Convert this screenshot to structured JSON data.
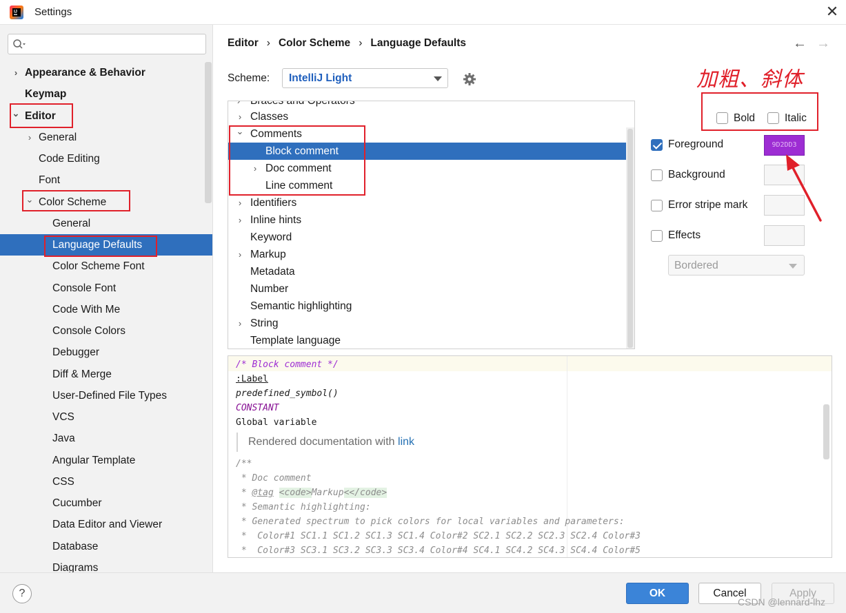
{
  "window": {
    "title": "Settings"
  },
  "search": {
    "placeholder": ""
  },
  "sidebar": {
    "items": [
      {
        "label": "Appearance & Behavior",
        "level": 0,
        "chevron": "right",
        "bold": true
      },
      {
        "label": "Keymap",
        "level": 0,
        "chevron": "none",
        "bold": true
      },
      {
        "label": "Editor",
        "level": 0,
        "chevron": "down",
        "bold": true
      },
      {
        "label": "General",
        "level": 1,
        "chevron": "right"
      },
      {
        "label": "Code Editing",
        "level": 1,
        "chevron": "none"
      },
      {
        "label": "Font",
        "level": 1,
        "chevron": "none"
      },
      {
        "label": "Color Scheme",
        "level": 1,
        "chevron": "down"
      },
      {
        "label": "General",
        "level": 2,
        "chevron": "none"
      },
      {
        "label": "Language Defaults",
        "level": 2,
        "chevron": "none",
        "selected": true
      },
      {
        "label": "Color Scheme Font",
        "level": 2,
        "chevron": "none"
      },
      {
        "label": "Console Font",
        "level": 2,
        "chevron": "none"
      },
      {
        "label": "Code With Me",
        "level": 2,
        "chevron": "none"
      },
      {
        "label": "Console Colors",
        "level": 2,
        "chevron": "none"
      },
      {
        "label": "Debugger",
        "level": 2,
        "chevron": "none"
      },
      {
        "label": "Diff & Merge",
        "level": 2,
        "chevron": "none"
      },
      {
        "label": "User-Defined File Types",
        "level": 2,
        "chevron": "none"
      },
      {
        "label": "VCS",
        "level": 2,
        "chevron": "none"
      },
      {
        "label": "Java",
        "level": 2,
        "chevron": "none"
      },
      {
        "label": "Angular Template",
        "level": 2,
        "chevron": "none"
      },
      {
        "label": "CSS",
        "level": 2,
        "chevron": "none"
      },
      {
        "label": "Cucumber",
        "level": 2,
        "chevron": "none"
      },
      {
        "label": "Data Editor and Viewer",
        "level": 2,
        "chevron": "none"
      },
      {
        "label": "Database",
        "level": 2,
        "chevron": "none"
      },
      {
        "label": "Diagrams",
        "level": 2,
        "chevron": "none"
      }
    ]
  },
  "breadcrumb": {
    "part1": "Editor",
    "part2": "Color Scheme",
    "part3": "Language Defaults",
    "sep": "›"
  },
  "scheme": {
    "label": "Scheme:",
    "value": "IntelliJ Light"
  },
  "annotation": {
    "text": "加粗、斜体"
  },
  "tree": {
    "partial_top": "Braces and Operators",
    "rows": [
      {
        "label": "Classes",
        "level": 0,
        "chevron": "right"
      },
      {
        "label": "Comments",
        "level": 0,
        "chevron": "down"
      },
      {
        "label": "Block comment",
        "level": 1,
        "chevron": "none",
        "selected": true
      },
      {
        "label": "Doc comment",
        "level": 1,
        "chevron": "right"
      },
      {
        "label": "Line comment",
        "level": 1,
        "chevron": "none"
      },
      {
        "label": "Identifiers",
        "level": 0,
        "chevron": "right"
      },
      {
        "label": "Inline hints",
        "level": 0,
        "chevron": "right"
      },
      {
        "label": "Keyword",
        "level": 0,
        "chevron": "none"
      },
      {
        "label": "Markup",
        "level": 0,
        "chevron": "right"
      },
      {
        "label": "Metadata",
        "level": 0,
        "chevron": "none"
      },
      {
        "label": "Number",
        "level": 0,
        "chevron": "none"
      },
      {
        "label": "Semantic highlighting",
        "level": 0,
        "chevron": "none"
      },
      {
        "label": "String",
        "level": 0,
        "chevron": "right"
      },
      {
        "label": "Template language",
        "level": 0,
        "chevron": "none"
      }
    ]
  },
  "attributes": {
    "bold": {
      "label": "Bold",
      "checked": false
    },
    "italic": {
      "label": "Italic",
      "checked": false
    },
    "foreground": {
      "label": "Foreground",
      "checked": true,
      "color_text": "9D2DD3",
      "color": "#9d2dd3"
    },
    "background": {
      "label": "Background",
      "checked": false
    },
    "error_stripe": {
      "label": "Error stripe mark",
      "checked": false
    },
    "effects": {
      "label": "Effects",
      "checked": false,
      "effect_type": "Bordered"
    }
  },
  "preview": {
    "line1": "/* Block comment */",
    "line2": ":Label",
    "line3": "predefined_symbol()",
    "line4": "CONSTANT",
    "line5": "Global variable",
    "rendered_text": "Rendered documentation with ",
    "rendered_link": "link",
    "doc1": "/**",
    "doc2": " * Doc comment",
    "doc3_prefix": " * ",
    "doc3_tag": "@tag",
    "doc3_space": " ",
    "doc3_code_open": "<code>",
    "doc3_markup": "Markup",
    "doc3_code_close": "<</code>",
    "doc4": " * Semantic highlighting:",
    "doc5": " * Generated spectrum to pick colors for local variables and parameters:",
    "doc6": " *  Color#1 SC1.1 SC1.2 SC1.3 SC1.4 Color#2 SC2.1 SC2.2 SC2.3 SC2.4 Color#3",
    "doc7": " *  Color#3 SC3.1 SC3.2 SC3.3 SC3.4 Color#4 SC4.1 SC4.2 SC4.3 SC4.4 Color#5"
  },
  "buttons": {
    "ok": "OK",
    "cancel": "Cancel",
    "apply": "Apply",
    "help": "?"
  },
  "watermark": "CSDN @lennard-lhz",
  "colors": {
    "accent": "#2f6fbd",
    "annotation": "#e0202a",
    "comment": "#9d2dd3"
  }
}
